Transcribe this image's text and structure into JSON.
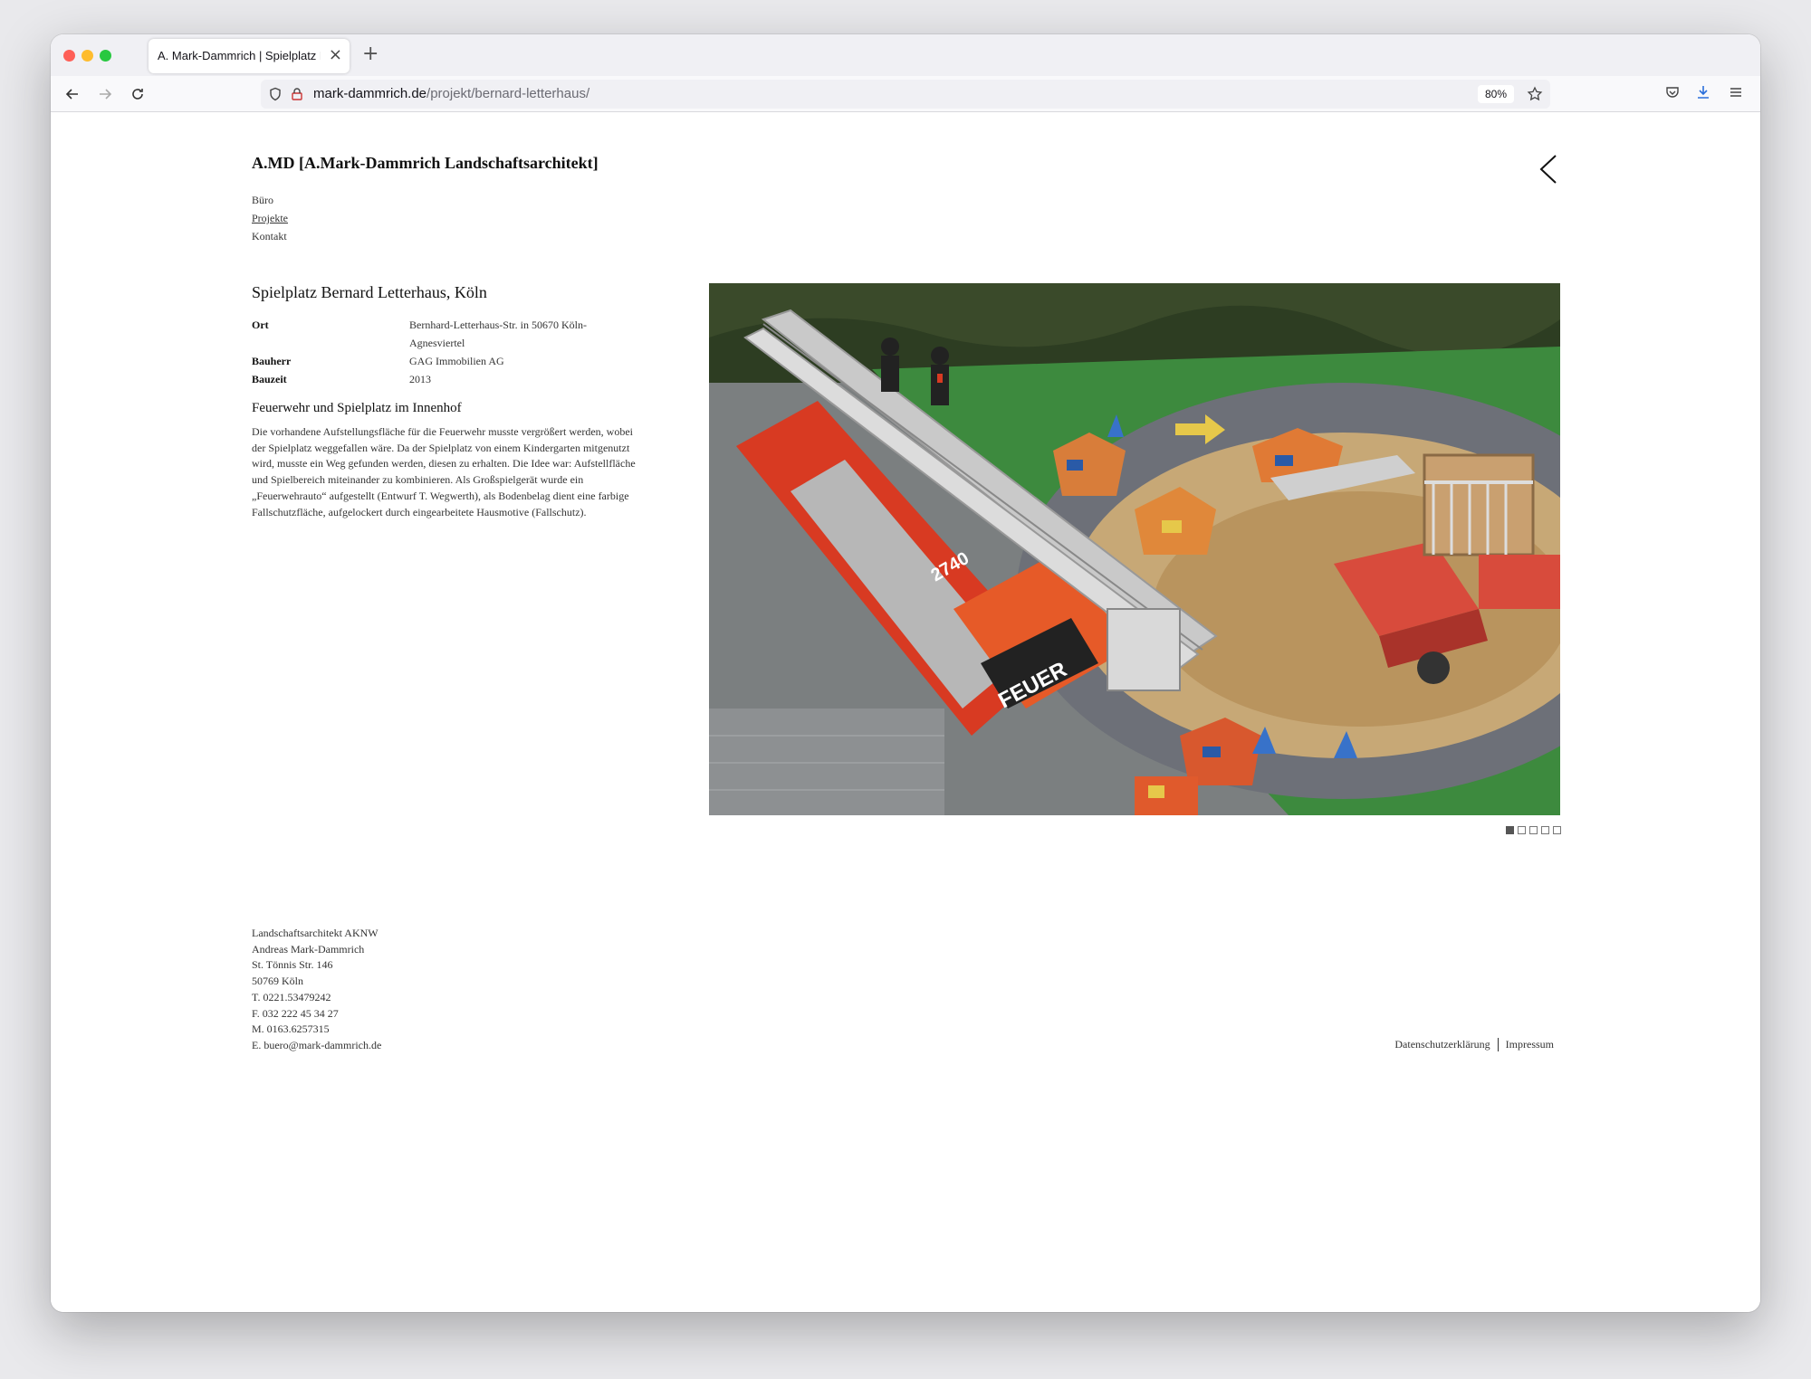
{
  "browser": {
    "tab_title": "A. Mark-Dammrich | Spielplatz Bernard Letterhaus",
    "tab_close": "×",
    "new_tab": "+",
    "url_domain": "mark-dammrich.de",
    "url_path": "/projekt/bernard-letterhaus/",
    "zoom": "80%",
    "icons": [
      "back-arrow-icon",
      "forward-arrow-icon",
      "reload-icon",
      "shield-icon",
      "lock-icon",
      "star-icon",
      "pocket-icon",
      "download-icon",
      "menu-icon"
    ]
  },
  "site": {
    "title": "A.MD [A.Mark-Dammrich Landschaftsarchitekt]",
    "nav": [
      "Büro",
      "Projekte",
      "Kontakt"
    ],
    "nav_active": "Projekte"
  },
  "project": {
    "title": "Spielplatz Bernard Letterhaus, Köln",
    "facts": [
      {
        "label": "Ort",
        "value": "Bernhard-Letterhaus-Str. in 50670 Köln-Agnesviertel"
      },
      {
        "label": "Bauherr",
        "value": "GAG Immobilien AG"
      },
      {
        "label": "Bauzeit",
        "value": "2013"
      }
    ],
    "subtitle": "Feuerwehr und Spielplatz im Innenhof",
    "description": "Die vorhandene Aufstellungsfläche für die Feuerwehr musste vergrößert werden, wobei der Spielplatz weggefallen wäre. Da der Spielplatz von einem Kindergarten mitgenutzt wird, musste ein Weg gefunden werden, diesen zu erhalten. Die Idee war: Aufstellfläche und Spielbereich miteinander zu kombinieren. Als Großspielgerät wurde ein „Feuerwehrauto“ aufgestellt (Entwurf T. Wegwerth), als Bodenbelag dient eine farbige Fallschutzfläche, aufgelockert durch eingearbeitete Hausmotive (Fallschutz).",
    "photo_text": "FEUER",
    "photo_number": "2740",
    "slides_total": 5,
    "slide_active": 1
  },
  "footer": {
    "address": [
      "Landschaftsarchitekt AKNW",
      "Andreas Mark-Dammrich",
      "St. Tönnis Str. 146",
      "50769 Köln",
      "T. 0221.53479242",
      "F. 032 222 45 34 27",
      "M. 0163.6257315",
      "E. buero@mark-dammrich.de"
    ],
    "links": [
      "Datenschutzerklärung",
      "Impressum"
    ]
  },
  "colors": {
    "fire_red": "#d83a22",
    "turf_green": "#3d8a3e",
    "sand": "#c7a876",
    "track_gray": "#6d7078"
  }
}
